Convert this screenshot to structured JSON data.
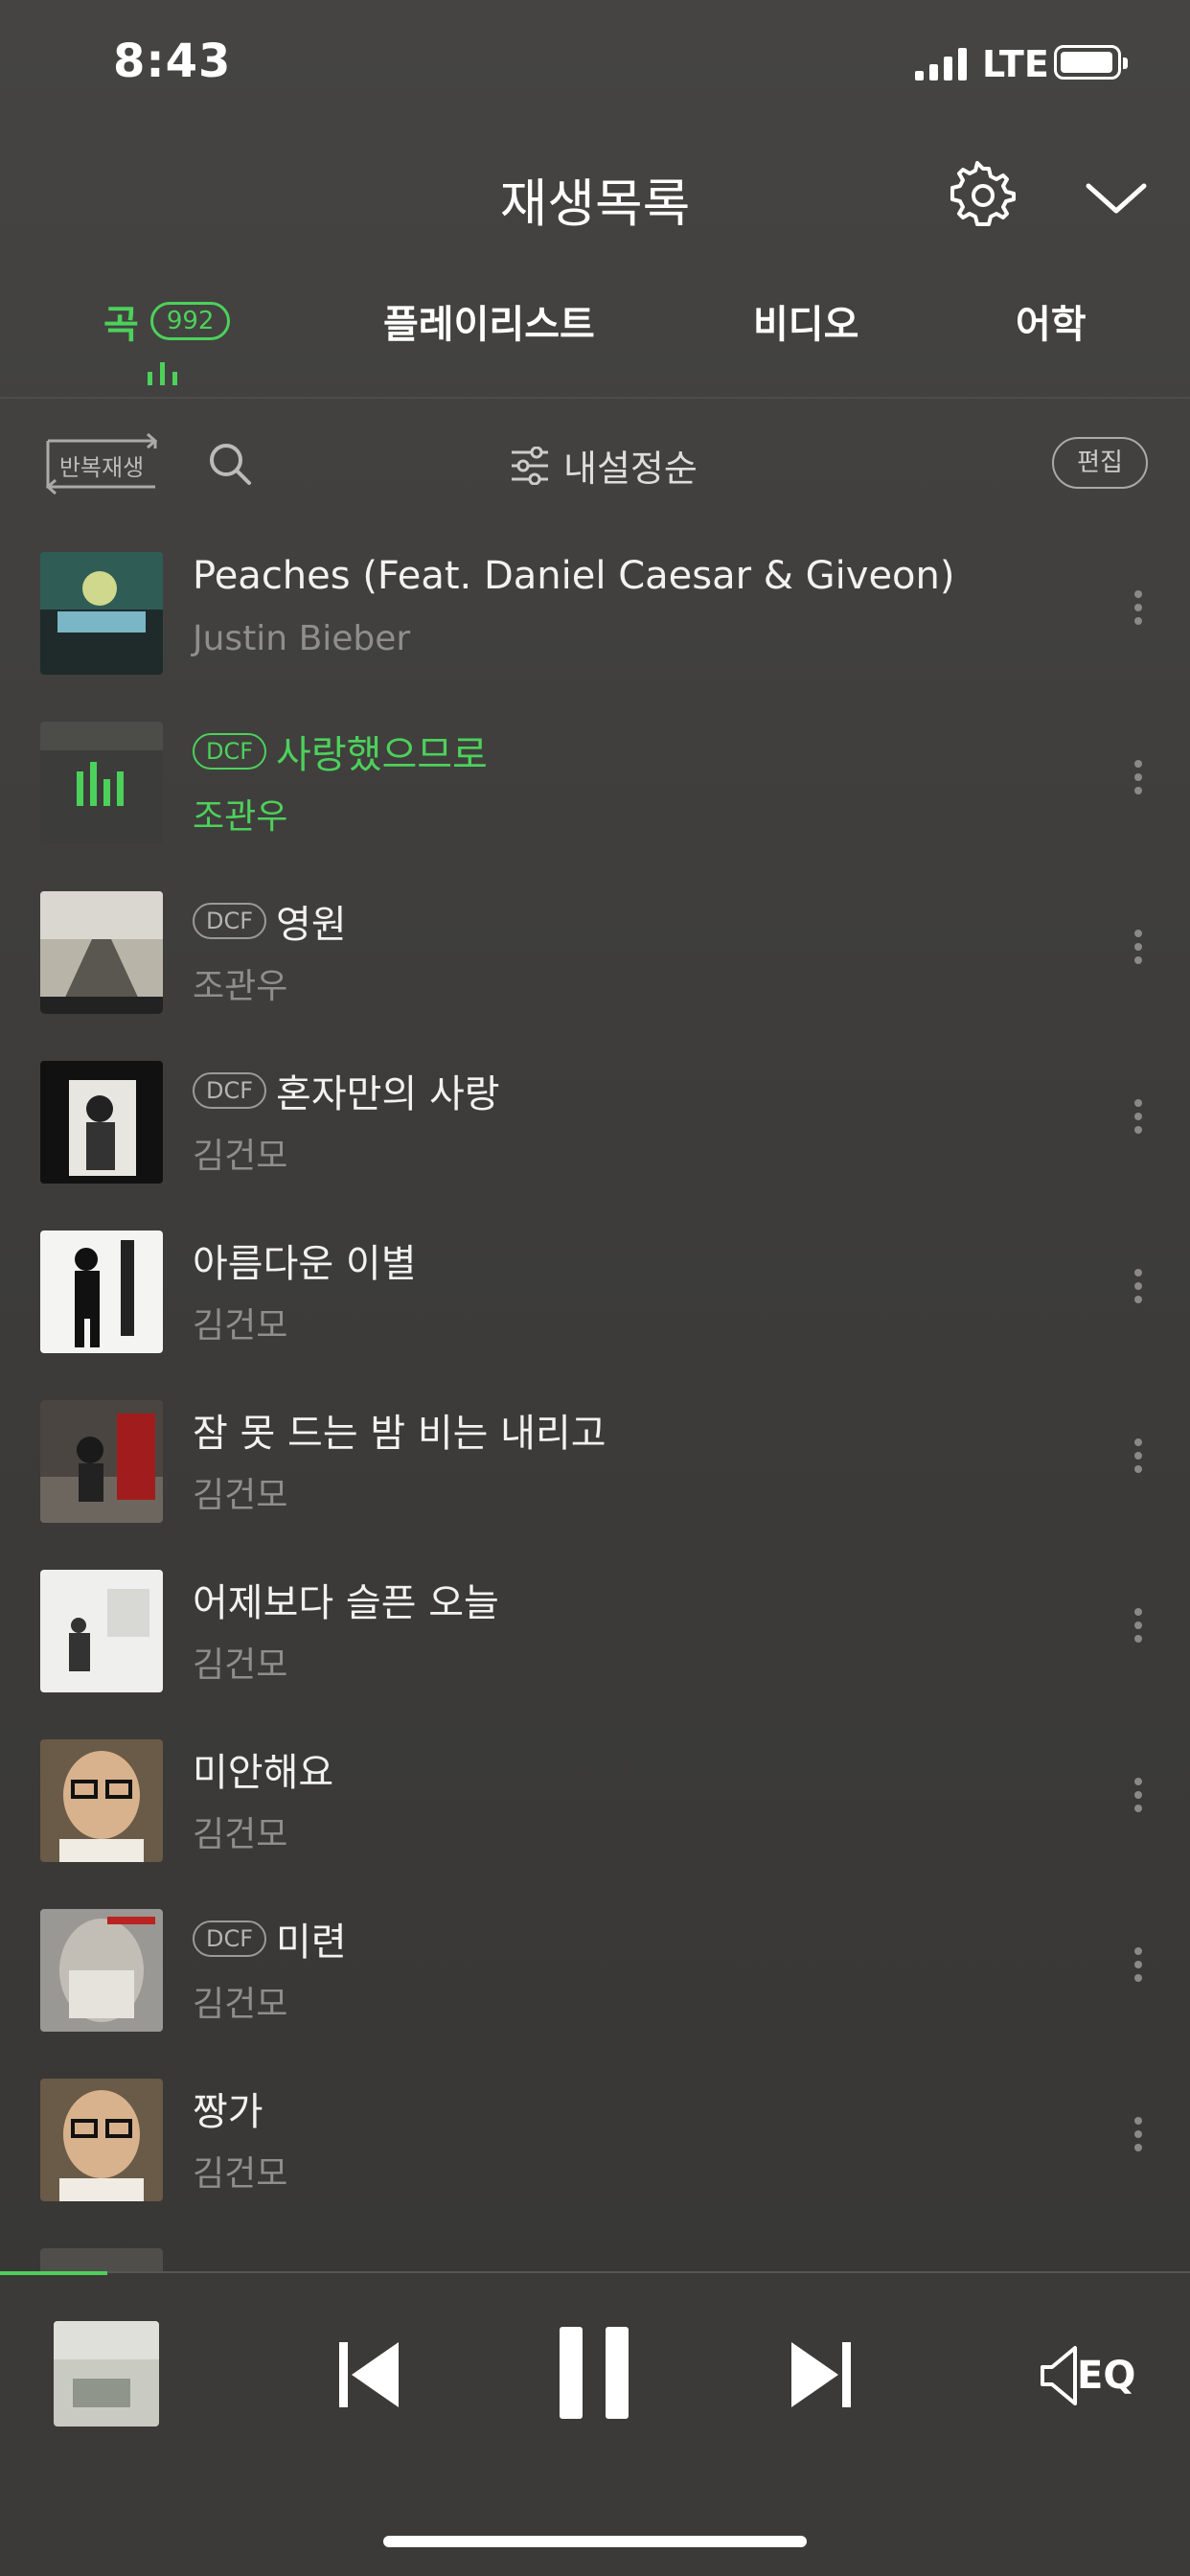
{
  "status": {
    "time": "8:43",
    "network": "LTE"
  },
  "header": {
    "title": "재생목록"
  },
  "tabs": [
    {
      "label": "곡",
      "count": "992",
      "active": true
    },
    {
      "label": "플레이리스트"
    },
    {
      "label": "비디오"
    },
    {
      "label": "어학"
    }
  ],
  "toolbar": {
    "repeat_label": "반복재생",
    "sort_label": "내설정순",
    "edit_label": "편집"
  },
  "songs": [
    {
      "title": "Peaches (Feat. Daniel Caesar & Giveon)",
      "artist": "Justin Bieber",
      "dcf": ""
    },
    {
      "title": "사랑했으므로",
      "artist": "조관우",
      "dcf": "DCF",
      "playing": true
    },
    {
      "title": "영원",
      "artist": "조관우",
      "dcf": "DCF"
    },
    {
      "title": "혼자만의 사랑",
      "artist": "김건모",
      "dcf": "DCF"
    },
    {
      "title": "아름다운 이별",
      "artist": "김건모",
      "dcf": ""
    },
    {
      "title": "잠 못 드는 밤 비는 내리고",
      "artist": "김건모",
      "dcf": ""
    },
    {
      "title": "어제보다 슬픈 오늘",
      "artist": "김건모",
      "dcf": ""
    },
    {
      "title": "미안해요",
      "artist": "김건모",
      "dcf": ""
    },
    {
      "title": "미련",
      "artist": "김건모",
      "dcf": "DCF"
    },
    {
      "title": "짱가",
      "artist": "김건모",
      "dcf": ""
    }
  ],
  "player": {
    "progress": 0.09,
    "eq_label": "EQ"
  },
  "colors": {
    "accent": "#4cd15b",
    "background": "#3e3d3b"
  }
}
